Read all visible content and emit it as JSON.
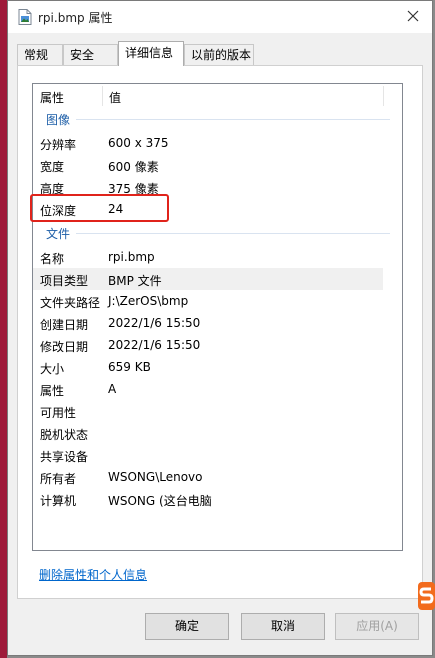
{
  "window": {
    "title": "rpi.bmp 属性",
    "close_icon": "close-icon"
  },
  "tabs": [
    {
      "label": "常规"
    },
    {
      "label": "安全"
    },
    {
      "label": "详细信息",
      "active": true
    },
    {
      "label": "以前的版本"
    }
  ],
  "details": {
    "header_property": "属性",
    "header_value": "值",
    "groups": [
      {
        "label": "图像",
        "rows": [
          {
            "name": "分辨率",
            "value": "600 x 375"
          },
          {
            "name": "宽度",
            "value": "600 像素"
          },
          {
            "name": "高度",
            "value": "375 像素"
          },
          {
            "name": "位深度",
            "value": "24"
          }
        ]
      },
      {
        "label": "文件",
        "rows": [
          {
            "name": "名称",
            "value": "rpi.bmp"
          },
          {
            "name": "项目类型",
            "value": "BMP 文件"
          },
          {
            "name": "文件夹路径",
            "value": "J:\\ZerOS\\bmp"
          },
          {
            "name": "创建日期",
            "value": "2022/1/6 15:50"
          },
          {
            "name": "修改日期",
            "value": "2022/1/6 15:50"
          },
          {
            "name": "大小",
            "value": "659 KB"
          },
          {
            "name": "属性",
            "value": "A"
          },
          {
            "name": "可用性",
            "value": ""
          },
          {
            "name": "脱机状态",
            "value": ""
          },
          {
            "name": "共享设备",
            "value": ""
          },
          {
            "name": "所有者",
            "value": "WSONG\\Lenovo"
          },
          {
            "name": "计算机",
            "value": "WSONG (这台电脑"
          }
        ]
      }
    ]
  },
  "remove_link": "删除属性和个人信息",
  "buttons": {
    "ok": "确定",
    "cancel": "取消",
    "apply": "应用(A)"
  },
  "colors": {
    "accent": "#9e1a3a",
    "group_label": "#1e5fa8",
    "link": "#0066cc",
    "highlight_box": "#e0231b"
  }
}
